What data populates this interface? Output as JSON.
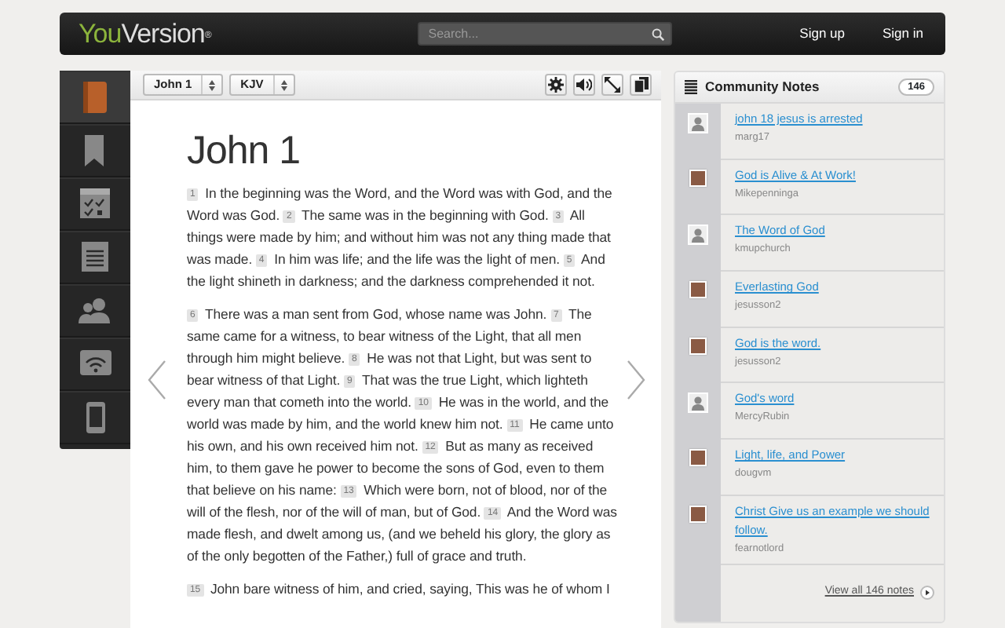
{
  "header": {
    "logo": {
      "part_1": "You",
      "part_2": "Version",
      "mark": "®"
    },
    "search": {
      "placeholder": "Search..."
    },
    "links": [
      "Sign up",
      "Sign in"
    ]
  },
  "sidebar": {
    "items": [
      {
        "kind": "book",
        "selected": true
      },
      {
        "kind": "bookmark",
        "selected": false
      },
      {
        "kind": "checklist",
        "selected": false
      },
      {
        "kind": "notes",
        "selected": false
      },
      {
        "kind": "people",
        "selected": false
      },
      {
        "kind": "wifi",
        "selected": false
      },
      {
        "kind": "phone",
        "selected": false
      }
    ]
  },
  "reader": {
    "selectors": [
      "John 1",
      "KJV"
    ],
    "tools": [
      {
        "kind": "settings"
      },
      {
        "kind": "audio"
      },
      {
        "kind": "fullscreen"
      },
      {
        "kind": "copy"
      }
    ],
    "title": "John 1",
    "paragraphs": [
      [
        {
          "number": "1",
          "text": "In the beginning was the Word, and the Word was with God, and the Word was God."
        },
        {
          "number": "2",
          "text": "The same was in the beginning with God."
        },
        {
          "number": "3",
          "text": "All things were made by him; and without him was not any thing made that was made."
        },
        {
          "number": "4",
          "text": "In him was life; and the life was the light of men."
        },
        {
          "number": "5",
          "text": "And the light shineth in darkness; and the darkness comprehended it not."
        }
      ],
      [
        {
          "number": "6",
          "text": "There was a man sent from God, whose name was John."
        },
        {
          "number": "7",
          "text": "The same came for a witness, to bear witness of the Light, that all men through him might believe."
        },
        {
          "number": "8",
          "text": "He was not that Light, but was sent to bear witness of that Light."
        },
        {
          "number": "9",
          "text": "That was the true Light, which lighteth every man that cometh into the world."
        },
        {
          "number": "10",
          "text": "He was in the world, and the world was made by him, and the world knew him not."
        },
        {
          "number": "11",
          "text": "He came unto his own, and his own received him not."
        },
        {
          "number": "12",
          "text": "But as many as received him, to them gave he power to become the sons of God, even to them that believe on his name:"
        },
        {
          "number": "13",
          "text": "Which were born, not of blood, nor of the will of the flesh, nor of the will of man, but of God."
        },
        {
          "number": "14",
          "text": "And the Word was made flesh, and dwelt among us, (and we beheld his glory, the glory as of the only begotten of the Father,) full of grace and truth."
        }
      ],
      [
        {
          "number": "15",
          "text": "John bare witness of him, and cried, saying, This was he of whom I"
        }
      ]
    ]
  },
  "notes": {
    "title": "Community Notes",
    "count": "146",
    "items": [
      {
        "title": "john 18 jesus is arrested",
        "author": "marg17",
        "avatar": {
          "kind": "silhouette"
        }
      },
      {
        "title": "God is Alive & At Work!",
        "author": "Mikepenninga",
        "avatar": {
          "kind": "photo"
        }
      },
      {
        "title": "The Word of God",
        "author": "kmupchurch",
        "avatar": {
          "kind": "silhouette"
        }
      },
      {
        "title": "Everlasting God",
        "author": "jesusson2",
        "avatar": {
          "kind": "photo"
        }
      },
      {
        "title": "God is the word.",
        "author": "jesusson2",
        "avatar": {
          "kind": "photo"
        }
      },
      {
        "title": "God's word",
        "author": "MercyRubin",
        "avatar": {
          "kind": "silhouette"
        }
      },
      {
        "title": "Light, life, and Power",
        "author": "dougvm",
        "avatar": {
          "kind": "photo"
        }
      },
      {
        "title": "Christ Give us an example we should follow.",
        "author": "fearnotlord",
        "avatar": {
          "kind": "photo"
        }
      }
    ],
    "footer": "View all 146 notes"
  }
}
